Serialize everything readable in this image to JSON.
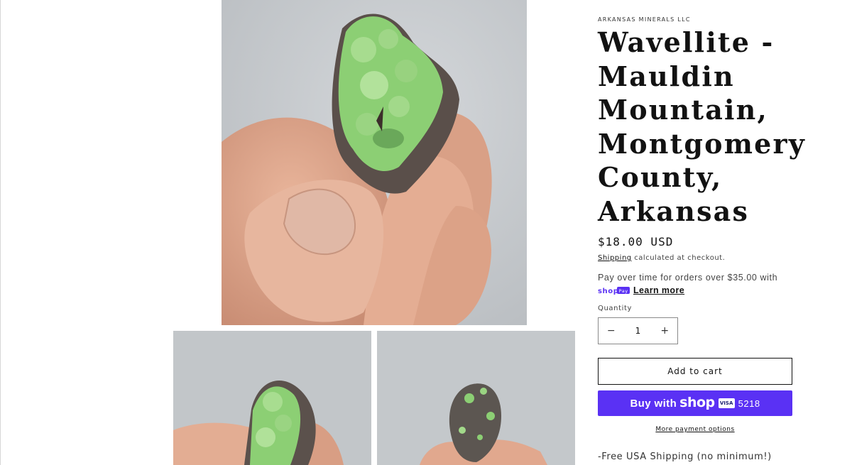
{
  "product": {
    "vendor": "ARKANSAS MINERALS LLC",
    "title": "Wavellite - Mauldin Mountain, Montgomery County, Arkansas",
    "price": "$18.00 USD",
    "shipping_link": "Shipping",
    "shipping_suffix": " calculated at checkout.",
    "installments_text": "Pay over time for orders over $35.00 with",
    "shoppay_badge": "shop Pay",
    "learn_more": "Learn more",
    "quantity_label": "Quantity",
    "quantity_value": "1",
    "add_to_cart": "Add to cart",
    "buy_with": "Buy with",
    "shop_word": "shop",
    "visa": "VISA",
    "card_last4": "5218",
    "more_payment_options": "More payment options",
    "description_first_line": "-Free USA Shipping (no minimum!)"
  },
  "icons": {
    "minus": "minus-icon",
    "plus": "plus-icon"
  },
  "colors": {
    "shop_pay_purple": "#5a31f4",
    "text": "#121212",
    "specimen_green": "#8ccf74",
    "photo_background": "#c6c9cc"
  }
}
